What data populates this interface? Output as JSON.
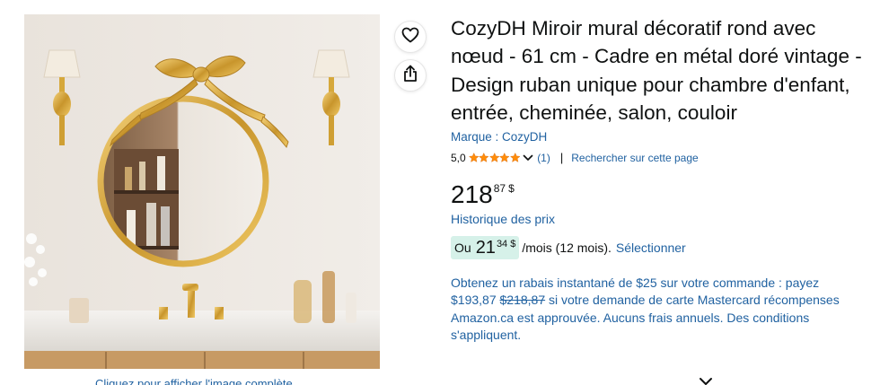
{
  "image": {
    "caption": "Cliquez pour afficher l'image complète"
  },
  "actions": {
    "wishlist_icon": "heart-icon",
    "share_icon": "share-icon"
  },
  "product": {
    "title": "CozyDH Miroir mural décoratif rond avec nœud - 61 cm - Cadre en métal doré vintage - Design ruban unique pour chambre d'enfant, entrée, cheminée, salon, couloir",
    "brand": "Marque : CozyDH",
    "rating_value": "5,0",
    "stars": 5,
    "review_count": "(1)",
    "separator": "|",
    "search_page": "Rechercher sur cette page"
  },
  "price": {
    "whole": "218",
    "fraction": "87",
    "currency": "$",
    "history_link": "Historique des prix"
  },
  "monthly": {
    "prefix": "Ou",
    "whole": "21",
    "fraction": "34",
    "currency": "$",
    "per_month": "/mois (12 mois).",
    "select": "Sélectionner"
  },
  "promo": {
    "part1": "Obtenez un rabais instantané de $25 sur votre commande : payez $193,87 ",
    "strike_price": "$218,87",
    "part2": " si votre demande de carte Mastercard récompenses Amazon.ca est approuvée. Aucuns frais annuels. Des conditions s'appliquent."
  },
  "colors": {
    "link": "#2162a1",
    "star": "#ff8d0a",
    "badge_bg": "#d6f1e9",
    "text": "#0f1111"
  }
}
